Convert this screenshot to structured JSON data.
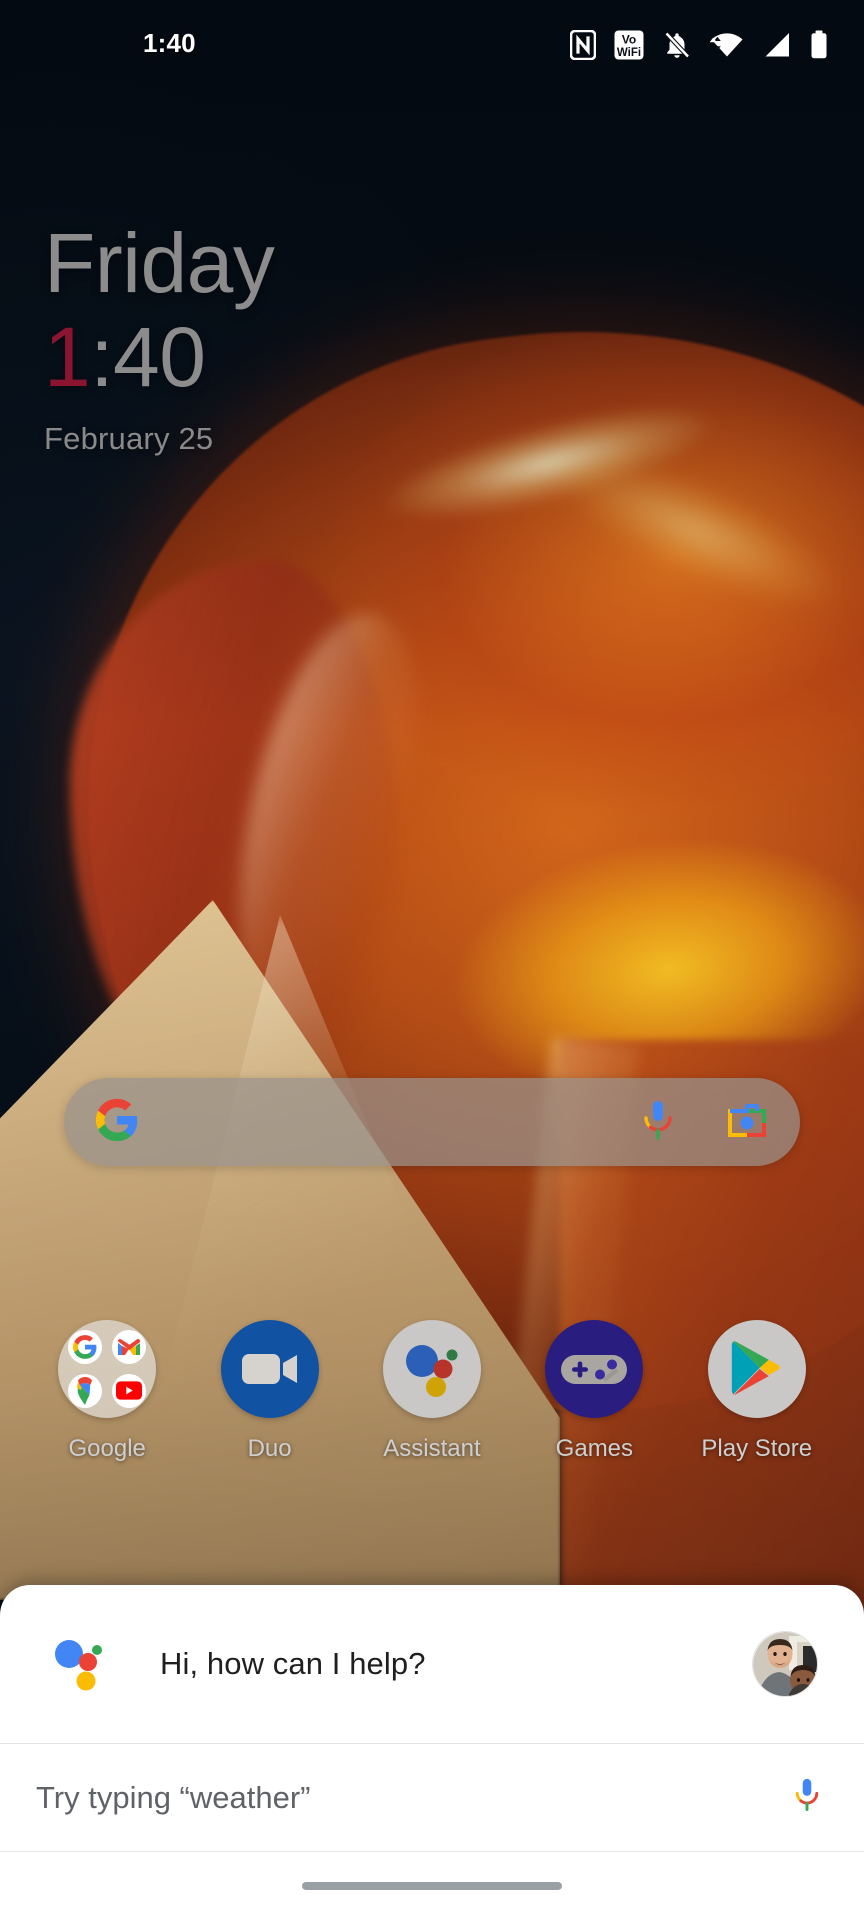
{
  "status_bar": {
    "time": "1:40",
    "icons": [
      {
        "name": "nfc-icon",
        "label": "NFC"
      },
      {
        "name": "vowifi-icon",
        "label": "VoWiFi",
        "line1": "Vo",
        "line2": "WiFi"
      },
      {
        "name": "ringer-muted-icon",
        "label": "Ringer muted"
      },
      {
        "name": "wifi-icon",
        "label": "Wi-Fi connected"
      },
      {
        "name": "cellular-signal-icon",
        "label": "Mobile signal"
      },
      {
        "name": "battery-icon",
        "label": "Battery full"
      }
    ]
  },
  "clock_widget": {
    "day": "Friday",
    "time_hour": "1",
    "time_rest": ":40",
    "date": "February 25",
    "hour_color": "#8b1530",
    "text_color": "#8c8c8c"
  },
  "search_bar": {
    "query": "",
    "placeholder": "",
    "google_logo_label": "Google",
    "mic_label": "Voice search",
    "lens_label": "Google Lens"
  },
  "dock": {
    "items": [
      {
        "label": "Google",
        "type": "folder",
        "icon_name": "google-folder-icon",
        "apps": [
          "Google",
          "Gmail",
          "Maps",
          "YouTube"
        ]
      },
      {
        "label": "Duo",
        "type": "app",
        "icon_name": "duo-icon",
        "color": "#1152a3"
      },
      {
        "label": "Assistant",
        "type": "app",
        "icon_name": "assistant-icon",
        "color": "#c9c8c6"
      },
      {
        "label": "Games",
        "type": "app",
        "icon_name": "games-icon",
        "color": "#2a1d80"
      },
      {
        "label": "Play Store",
        "type": "app",
        "icon_name": "play-store-icon",
        "color": "#c9c8c6"
      }
    ]
  },
  "assistant_panel": {
    "greeting": "Hi, how can I help?",
    "input_placeholder": "Try typing “weather”",
    "logo_name": "google-assistant-logo",
    "avatar_name": "user-avatar",
    "mic_name": "assistant-mic-icon"
  },
  "colors": {
    "google_blue": "#4285F4",
    "google_red": "#EA4335",
    "google_yellow": "#FBBC05",
    "google_green": "#34A853",
    "panel_background": "#FFFFFF",
    "wallpaper_dark": "#050d15",
    "wallpaper_orange": "#d4671a",
    "wallpaper_tan": "#d9b887"
  }
}
